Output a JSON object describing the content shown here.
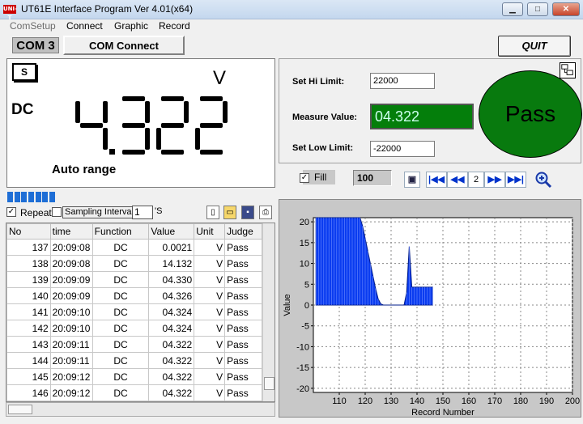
{
  "window": {
    "title": "UT61E Interface Program Ver 4.01(x64)",
    "icon_text": "UNI-T",
    "min_icon": "minimize-icon",
    "max_icon": "maximize-icon",
    "close_icon": "close-icon"
  },
  "menu": [
    "ComSetup",
    "Connect",
    "Graphic",
    "Record"
  ],
  "com": {
    "port": "COM 3",
    "status": "COM Connect"
  },
  "quit_label": "QUIT",
  "lcd": {
    "badge": "S",
    "unit": "V",
    "mode": "DC",
    "value": "4.322",
    "range": "Auto range"
  },
  "limits": {
    "hi_label": "Set Hi Limit:",
    "hi_value": "22000",
    "measure_label": "Measure Value:",
    "measure_value": "04.322",
    "low_label": "Set Low Limit:",
    "low_value": "-22000",
    "judge": "Pass",
    "judge_color": "#087a0e"
  },
  "controls": {
    "fill_label": "Fill",
    "fill_checked": true,
    "record_count": "100",
    "page": "2"
  },
  "progress_blocks": 7,
  "options": {
    "repeat_label": "Repeat",
    "repeat_checked": true,
    "sampling_label": "Sampling Interval",
    "sampling_value": "1",
    "sampling_unit": "'S"
  },
  "table": {
    "columns": [
      "No",
      "time",
      "Function",
      "Value",
      "Unit",
      "Judge"
    ],
    "rows": [
      [
        "137",
        "20:09:08",
        "DC",
        "0.0021",
        "V",
        "Pass"
      ],
      [
        "138",
        "20:09:08",
        "DC",
        "14.132",
        "V",
        "Pass"
      ],
      [
        "139",
        "20:09:09",
        "DC",
        "04.330",
        "V",
        "Pass"
      ],
      [
        "140",
        "20:09:09",
        "DC",
        "04.326",
        "V",
        "Pass"
      ],
      [
        "141",
        "20:09:10",
        "DC",
        "04.324",
        "V",
        "Pass"
      ],
      [
        "142",
        "20:09:10",
        "DC",
        "04.324",
        "V",
        "Pass"
      ],
      [
        "143",
        "20:09:11",
        "DC",
        "04.322",
        "V",
        "Pass"
      ],
      [
        "144",
        "20:09:11",
        "DC",
        "04.322",
        "V",
        "Pass"
      ],
      [
        "145",
        "20:09:12",
        "DC",
        "04.322",
        "V",
        "Pass"
      ],
      [
        "146",
        "20:09:12",
        "DC",
        "04.322",
        "V",
        "Pass"
      ]
    ]
  },
  "chart_data": {
    "type": "area",
    "xlabel": "Record Number",
    "ylabel": "Value",
    "xlim": [
      100,
      200
    ],
    "ylim": [
      -21,
      21
    ],
    "xticks": [
      110,
      120,
      130,
      140,
      150,
      160,
      170,
      180,
      190,
      200
    ],
    "yticks": [
      20,
      15,
      10,
      5,
      0,
      -5,
      -10,
      -15,
      -20
    ],
    "grid": true,
    "fill_color": "#0a3cf0",
    "x": [
      101,
      102,
      103,
      104,
      105,
      106,
      107,
      108,
      109,
      110,
      111,
      112,
      113,
      114,
      115,
      116,
      117,
      118,
      119,
      120,
      121,
      122,
      123,
      124,
      125,
      126,
      127,
      128,
      129,
      130,
      131,
      132,
      133,
      134,
      135,
      136,
      137,
      138,
      139,
      140,
      141,
      142,
      143,
      144,
      145,
      146
    ],
    "y": [
      22,
      22,
      22,
      22,
      22,
      22,
      22,
      22,
      22,
      22,
      22,
      22,
      22,
      22,
      22,
      22,
      22,
      22,
      19,
      16,
      13,
      10,
      7,
      4,
      1.5,
      0.3,
      0,
      0,
      0,
      0,
      0,
      0,
      0,
      0,
      0,
      3,
      14.1,
      4.3,
      4.3,
      4.3,
      4.3,
      4.3,
      4.3,
      4.3,
      4.3,
      4.3
    ]
  }
}
